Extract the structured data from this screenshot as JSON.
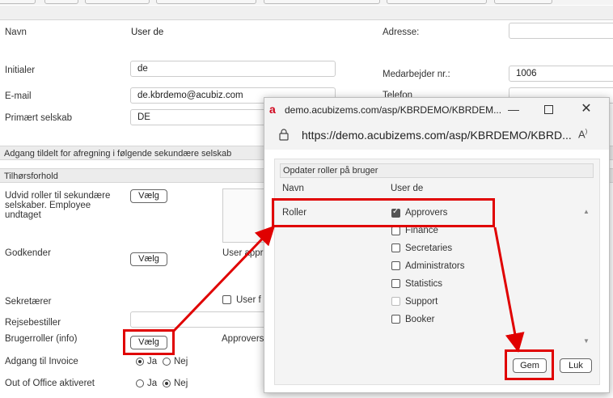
{
  "form": {
    "navn_label": "Navn",
    "navn_value": "User de",
    "adresse_label": "Adresse:",
    "initialer_label": "Initialer",
    "initialer_value": "de",
    "medarbejder_label": "Medarbejder nr.:",
    "medarbejder_value": "1006",
    "email_label": "E-mail",
    "email_value": "de.kbrdemo@acubiz.com",
    "telefon_label": "Telefon",
    "primaert_label": "Primært selskab",
    "primaert_value": "DE",
    "section_adgang": "Adgang tildelt for afregning i følgende sekundære selskab",
    "section_tilhor": "Tilhørsforhold",
    "udvid_label": "Udvid roller til sekundære selskaber. Employee undtaget",
    "godkender_label": "Godkender",
    "godkender_side": "User appr",
    "sekretaerer_label": "Sekretærer",
    "sekretaerer_side": "User f",
    "rejse_label": "Rejsebestiller",
    "brugerroller_label": "Brugerroller (info)",
    "brugerroller_side": "Approvers",
    "invoice_label": "Adgang til Invoice",
    "ooo_label": "Out of Office aktiveret",
    "ja": "Ja",
    "nej": "Nej",
    "vaelg": "Vælg"
  },
  "popup": {
    "title": "demo.acubizems.com/asp/KBRDEMO/KBRDEM...",
    "url": "https://demo.acubizems.com/asp/KBRDEMO/KBRD...",
    "header": "Opdater roller på bruger",
    "navn_label": "Navn",
    "navn_value": "User de",
    "roller_label": "Roller",
    "roles": [
      {
        "label": "Approvers",
        "checked": true,
        "disabled": false
      },
      {
        "label": "Finance",
        "checked": false,
        "disabled": false
      },
      {
        "label": "Secretaries",
        "checked": false,
        "disabled": false
      },
      {
        "label": "Administrators",
        "checked": false,
        "disabled": false
      },
      {
        "label": "Statistics",
        "checked": false,
        "disabled": false
      },
      {
        "label": "Support",
        "checked": false,
        "disabled": true
      },
      {
        "label": "Booker",
        "checked": false,
        "disabled": false
      }
    ],
    "gem": "Gem",
    "luk": "Luk"
  },
  "colors": {
    "annotation_red": "#e00000",
    "brand_red": "#d0021b"
  }
}
